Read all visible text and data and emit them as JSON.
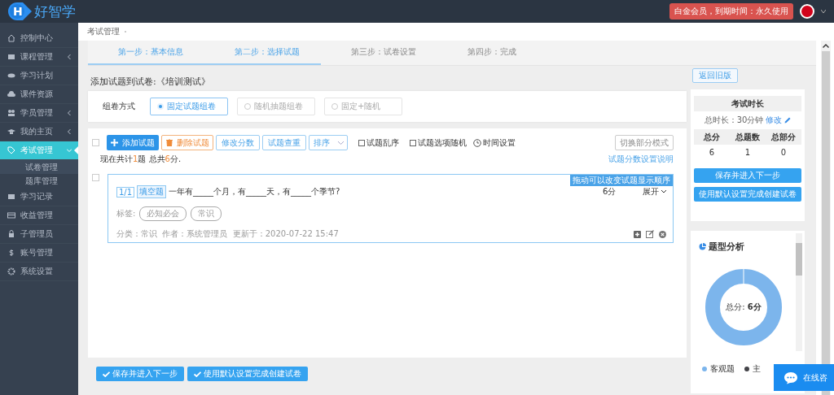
{
  "header": {
    "logo_letter": "H",
    "logo_text": "好智学",
    "member_badge": "白金会员，到期时间：永久使用"
  },
  "sidebar": {
    "items": [
      {
        "label": "控制中心",
        "expandable": false,
        "selected": false
      },
      {
        "label": "课程管理",
        "expandable": true,
        "selected": false
      },
      {
        "label": "学习计划",
        "expandable": false,
        "selected": false
      },
      {
        "label": "课件资源",
        "expandable": false,
        "selected": false
      },
      {
        "label": "学员管理",
        "expandable": true,
        "selected": false
      },
      {
        "label": "我的主页",
        "expandable": true,
        "selected": false
      },
      {
        "label": "考试管理",
        "expandable": true,
        "selected": true,
        "children": [
          {
            "label": "试卷管理",
            "selected": true
          },
          {
            "label": "题库管理",
            "selected": false
          }
        ]
      },
      {
        "label": "学习记录",
        "expandable": false,
        "selected": false
      },
      {
        "label": "收益管理",
        "expandable": false,
        "selected": false
      },
      {
        "label": "子管理员",
        "expandable": false,
        "selected": false
      },
      {
        "label": "账号管理",
        "expandable": false,
        "selected": false
      },
      {
        "label": "系统设置",
        "expandable": false,
        "selected": false
      }
    ]
  },
  "breadcrumb": "考试管理",
  "steps": [
    {
      "label": "第一步：基本信息",
      "active": true
    },
    {
      "label": "第二步：选择试题",
      "active": true
    },
    {
      "label": "第三步：试卷设置",
      "active": false
    },
    {
      "label": "第四步：完成",
      "active": false
    }
  ],
  "page_title": "添加试题到试卷:《培训测试》",
  "back_button": "返回旧版",
  "mode": {
    "label": "组卷方式",
    "options": [
      {
        "label": "固定试题组卷",
        "selected": true
      },
      {
        "label": "随机抽题组卷",
        "selected": false
      },
      {
        "label": "固定+随机",
        "selected": false
      }
    ]
  },
  "toolbar": {
    "select_all": false,
    "buttons": [
      {
        "label": "添加试题",
        "kind": "primary"
      },
      {
        "label": "删除试题",
        "kind": "danger"
      },
      {
        "label": "修改分数",
        "kind": "outline"
      },
      {
        "label": "试题查重",
        "kind": "outline"
      },
      {
        "label": "排序",
        "kind": "dropdown"
      }
    ],
    "options": [
      {
        "label": "试题乱序",
        "checked": false
      },
      {
        "label": "试题选项随机",
        "checked": false
      }
    ],
    "time_setting": "时间设置",
    "mode_switch": "切换部分模式"
  },
  "summary": "现在共计**1**题 总共**6**分.",
  "score_help_link": "试题分数设置说明",
  "questions": [
    {
      "checked": false,
      "drag_hint": "拖动可以改变试题显示顺序",
      "index": "1/1",
      "type": "填空题",
      "text": "一年有_____个月，有_____天，有_____个季节?",
      "score": "6分",
      "expand": "展开",
      "tag_label": "标签:",
      "tags": [
        "必知必会",
        "常识"
      ],
      "meta": "分类：常识  作者：系统管理员  更新于：2020-07-22 15:47"
    }
  ],
  "bottom_buttons": [
    "保存并进入下一步",
    "使用默认设置完成创建试卷"
  ],
  "stats": {
    "title": "考试时长",
    "duration": "总时长：30分钟",
    "edit": "修改",
    "columns": [
      "总分",
      "总题数",
      "总部分"
    ],
    "values": [
      "6",
      "1",
      "0"
    ],
    "buttons": [
      "保存并进入下一步",
      "使用默认设置完成创建试卷"
    ]
  },
  "analysis": {
    "title": "题型分析",
    "center": "总分: **6分**",
    "legend": [
      {
        "label": "客观题",
        "color": "#7cb5ec"
      },
      {
        "label": "主",
        "color": "#434348"
      }
    ]
  },
  "chat": "在线咨"
}
